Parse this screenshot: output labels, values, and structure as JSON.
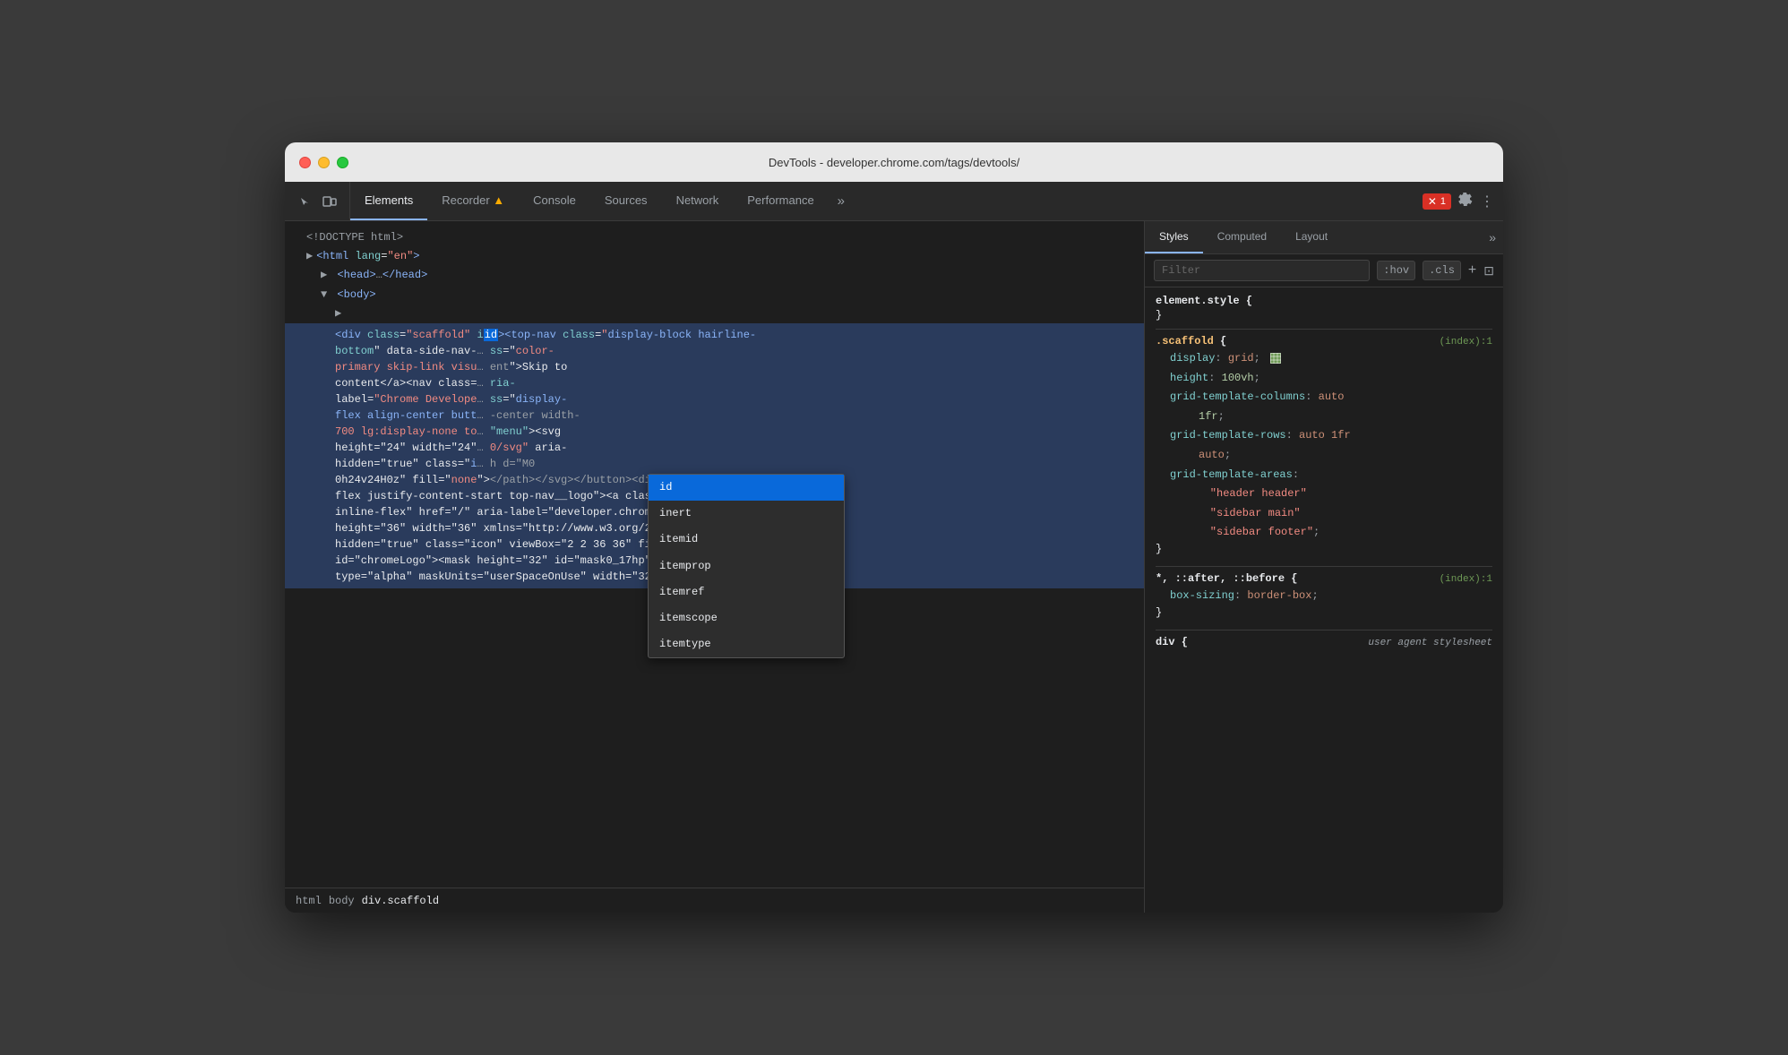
{
  "window": {
    "title": "DevTools - developer.chrome.com/tags/devtools/"
  },
  "tabs": {
    "items": [
      {
        "id": "elements",
        "label": "Elements",
        "active": true
      },
      {
        "id": "recorder",
        "label": "Recorder 🔺",
        "active": false
      },
      {
        "id": "console",
        "label": "Console",
        "active": false
      },
      {
        "id": "sources",
        "label": "Sources",
        "active": false
      },
      {
        "id": "network",
        "label": "Network",
        "active": false
      },
      {
        "id": "performance",
        "label": "Performance",
        "active": false
      }
    ],
    "more": "»",
    "error_count": "1",
    "settings_label": "⚙",
    "more_label": "⋮"
  },
  "dom": {
    "lines": [
      {
        "text": "<!DOCTYPE html>",
        "type": "doctype",
        "indent": 0
      },
      {
        "text": "<html lang=\"en\">",
        "type": "tag",
        "indent": 0
      },
      {
        "text": "▶ <head>…</head>",
        "type": "collapsed",
        "indent": 1
      },
      {
        "text": "▼ <body>",
        "type": "open",
        "indent": 1
      },
      {
        "text": "▶",
        "type": "arrow",
        "indent": 2
      },
      {
        "text_html": "<div class=\"scaffold\" id=…<top-nav class=\"display-block hairline-bottom\" data-side-nav-…",
        "type": "selected",
        "indent": 2
      }
    ],
    "selected_content": "<div class=\"scaffold\" id=…<top-nav class=\"display-block hairline-bottom\" data-side-nav-… ss=\"color-primary skip-link visu… ent\">Skip to content</a><nav class=… ria-label=\"Chrome Develope… ss=\"display-flex align-center butt… -center width-700 lg:display-none to… height=\"24\" width=\"24\"… \"menu\"><svg height=\"24\" aria-hidden=\"true\" class=\"i… 0h24v24H0z\" fill=\"none\"></path></svg></button><div class=\"display-flex justify-content-start top-nav__logo\"><a class=\"display-inline-flex\" href=\"/\" aria-label=\"developer.chrome.com\"><svg height=\"36\" width=\"36\" xmlns=\"http://www.w3.org/2000/svg\" aria-hidden=\"true\" class=\"icon\" viewBox=\"2 2 36 36\" fill=\"none\" id=\"chromeLogo\"><mask height=\"32\" id=\"mask0_17hp\" mask-type=\"alpha\" maskUnits=\"userSpaceOnUse\" width=\"32\" x=\"4\" y=\"4\">"
  },
  "autocomplete": {
    "items": [
      {
        "label": "id",
        "highlighted": true
      },
      {
        "label": "inert",
        "highlighted": false
      },
      {
        "label": "itemid",
        "highlighted": false
      },
      {
        "label": "itemprop",
        "highlighted": false
      },
      {
        "label": "itemref",
        "highlighted": false
      },
      {
        "label": "itemscope",
        "highlighted": false
      },
      {
        "label": "itemtype",
        "highlighted": false
      }
    ]
  },
  "breadcrumb": {
    "items": [
      {
        "label": "html",
        "active": false
      },
      {
        "label": "body",
        "active": false
      },
      {
        "label": "div.scaffold",
        "active": true
      }
    ]
  },
  "styles": {
    "tabs": [
      {
        "label": "Styles",
        "active": true
      },
      {
        "label": "Computed",
        "active": false
      },
      {
        "label": "Layout",
        "active": false
      }
    ],
    "filter_placeholder": "Filter",
    "filter_buttons": [
      ":hov",
      ".cls"
    ],
    "blocks": [
      {
        "selector": "element.style {",
        "source": "",
        "props": [],
        "close": "}"
      },
      {
        "selector": ".scaffold {",
        "source": "(index):1",
        "props": [
          {
            "key": "display",
            "value": "grid",
            "extra": "grid-icon"
          },
          {
            "key": "height",
            "value": "100vh",
            "type": "string"
          },
          {
            "key": "grid-template-columns",
            "value": "auto 1fr",
            "type": "string"
          },
          {
            "key": "grid-template-rows",
            "value": "auto 1fr auto",
            "type": "string"
          },
          {
            "key": "grid-template-areas",
            "value": "\"header header\" \"sidebar main\" \"sidebar footer\";",
            "type": "string"
          }
        ],
        "close": "}"
      },
      {
        "selector": "*, ::after, ::before {",
        "source": "(index):1",
        "props": [
          {
            "key": "box-sizing",
            "value": "border-box",
            "type": "keyword"
          }
        ],
        "close": "}"
      },
      {
        "selector": "div {",
        "source": "user agent stylesheet",
        "props": [],
        "close": ""
      }
    ]
  }
}
